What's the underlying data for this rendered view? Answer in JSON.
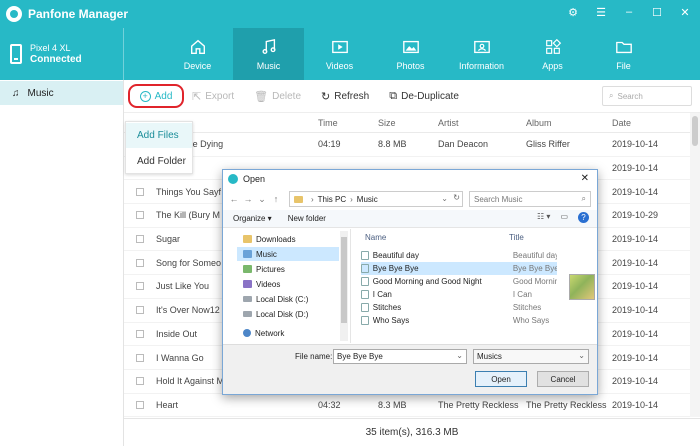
{
  "app": {
    "title": "Panfone Manager"
  },
  "device": {
    "name": "Pixel 4 XL",
    "status": "Connected"
  },
  "nav": [
    {
      "label": "Device",
      "icon": "home-icon"
    },
    {
      "label": "Music",
      "icon": "music-note-icon"
    },
    {
      "label": "Videos",
      "icon": "video-icon"
    },
    {
      "label": "Photos",
      "icon": "photo-icon"
    },
    {
      "label": "Information",
      "icon": "contact-card-icon"
    },
    {
      "label": "Apps",
      "icon": "apps-grid-icon"
    },
    {
      "label": "File",
      "icon": "folder-icon"
    }
  ],
  "sidebar": {
    "items": [
      {
        "label": "Music",
        "icon": "music-note-icon"
      }
    ]
  },
  "toolbar": {
    "add": "Add",
    "export": "Export",
    "delete": "Delete",
    "refresh": "Refresh",
    "dedupe": "De-Duplicate",
    "search_placeholder": "Search"
  },
  "dropdown": {
    "items": [
      "Add Files",
      "Add Folder"
    ]
  },
  "table": {
    "headers": {
      "time": "Time",
      "size": "Size",
      "artist": "Artist",
      "album": "Album",
      "date": "Date"
    },
    "rows": [
      {
        "name": "Was Done Dying",
        "time": "04:19",
        "size": "8.8 MB",
        "artist": "Dan Deacon",
        "album": "Gliss Riffer",
        "date": "2019-10-14"
      },
      {
        "name": "",
        "time": "",
        "size": "",
        "artist": "",
        "album": "",
        "date": "2019-10-14"
      },
      {
        "name": "Things You Sayf",
        "time": "",
        "size": "",
        "artist": "",
        "album": "",
        "date": "2019-10-14"
      },
      {
        "name": "The Kill (Bury M",
        "time": "",
        "size": "",
        "artist": "",
        "album": "",
        "date": "2019-10-29"
      },
      {
        "name": "Sugar",
        "time": "",
        "size": "",
        "artist": "",
        "album": "",
        "date": "2019-10-14"
      },
      {
        "name": "Song for Someo",
        "time": "",
        "size": "",
        "artist": "",
        "album": "",
        "date": "2019-10-14"
      },
      {
        "name": "Just Like You",
        "time": "",
        "size": "",
        "artist": "",
        "album": "",
        "date": "2019-10-14"
      },
      {
        "name": "It's Over Now12",
        "time": "",
        "size": "",
        "artist": "",
        "album": "",
        "date": "2019-10-14"
      },
      {
        "name": "Inside Out",
        "time": "",
        "size": "",
        "artist": "",
        "album": "",
        "date": "2019-10-14"
      },
      {
        "name": "I Wanna Go",
        "time": "",
        "size": "",
        "artist": "",
        "album": "",
        "date": "2019-10-14"
      },
      {
        "name": "Hold It Against M",
        "time": "",
        "size": "",
        "artist": "",
        "album": "",
        "date": "2019-10-14"
      },
      {
        "name": "Heart",
        "time": "04:32",
        "size": "8.3 MB",
        "artist": "The Pretty Reckless",
        "album": "The Pretty Reckless",
        "date": "2019-10-14"
      }
    ]
  },
  "footer": {
    "summary": "35 item(s), 316.3 MB"
  },
  "dialog": {
    "title": "Open",
    "path": [
      "This PC",
      "Music"
    ],
    "search_placeholder": "Search Music",
    "organize": "Organize ▾",
    "new_folder": "New folder",
    "tree": [
      {
        "label": "Downloads",
        "icon": "folder"
      },
      {
        "label": "Music",
        "icon": "music",
        "selected": true
      },
      {
        "label": "Pictures",
        "icon": "pics"
      },
      {
        "label": "Videos",
        "icon": "video"
      },
      {
        "label": "Local Disk (C:)",
        "icon": "disk"
      },
      {
        "label": "Local Disk (D:)",
        "icon": "disk"
      },
      {
        "label": "Network",
        "icon": "net"
      }
    ],
    "columns": {
      "name": "Name",
      "title": "Title"
    },
    "files": [
      {
        "name": "Beautiful day",
        "title": "Beautiful day"
      },
      {
        "name": "Bye Bye Bye",
        "title": "Bye Bye Bye",
        "selected": true
      },
      {
        "name": "Good Morning and Good Night",
        "title": "Good Morning"
      },
      {
        "name": "I Can",
        "title": "I Can"
      },
      {
        "name": "Stitches",
        "title": "Stitches"
      },
      {
        "name": "Who Says",
        "title": "Who Says"
      }
    ],
    "filename_label": "File name:",
    "filename_value": "Bye Bye Bye",
    "filetype": "Musics",
    "open": "Open",
    "cancel": "Cancel"
  },
  "colors": {
    "accent": "#27b9c6",
    "accent_dark": "#1f9fac",
    "highlight": "#e0242b"
  }
}
